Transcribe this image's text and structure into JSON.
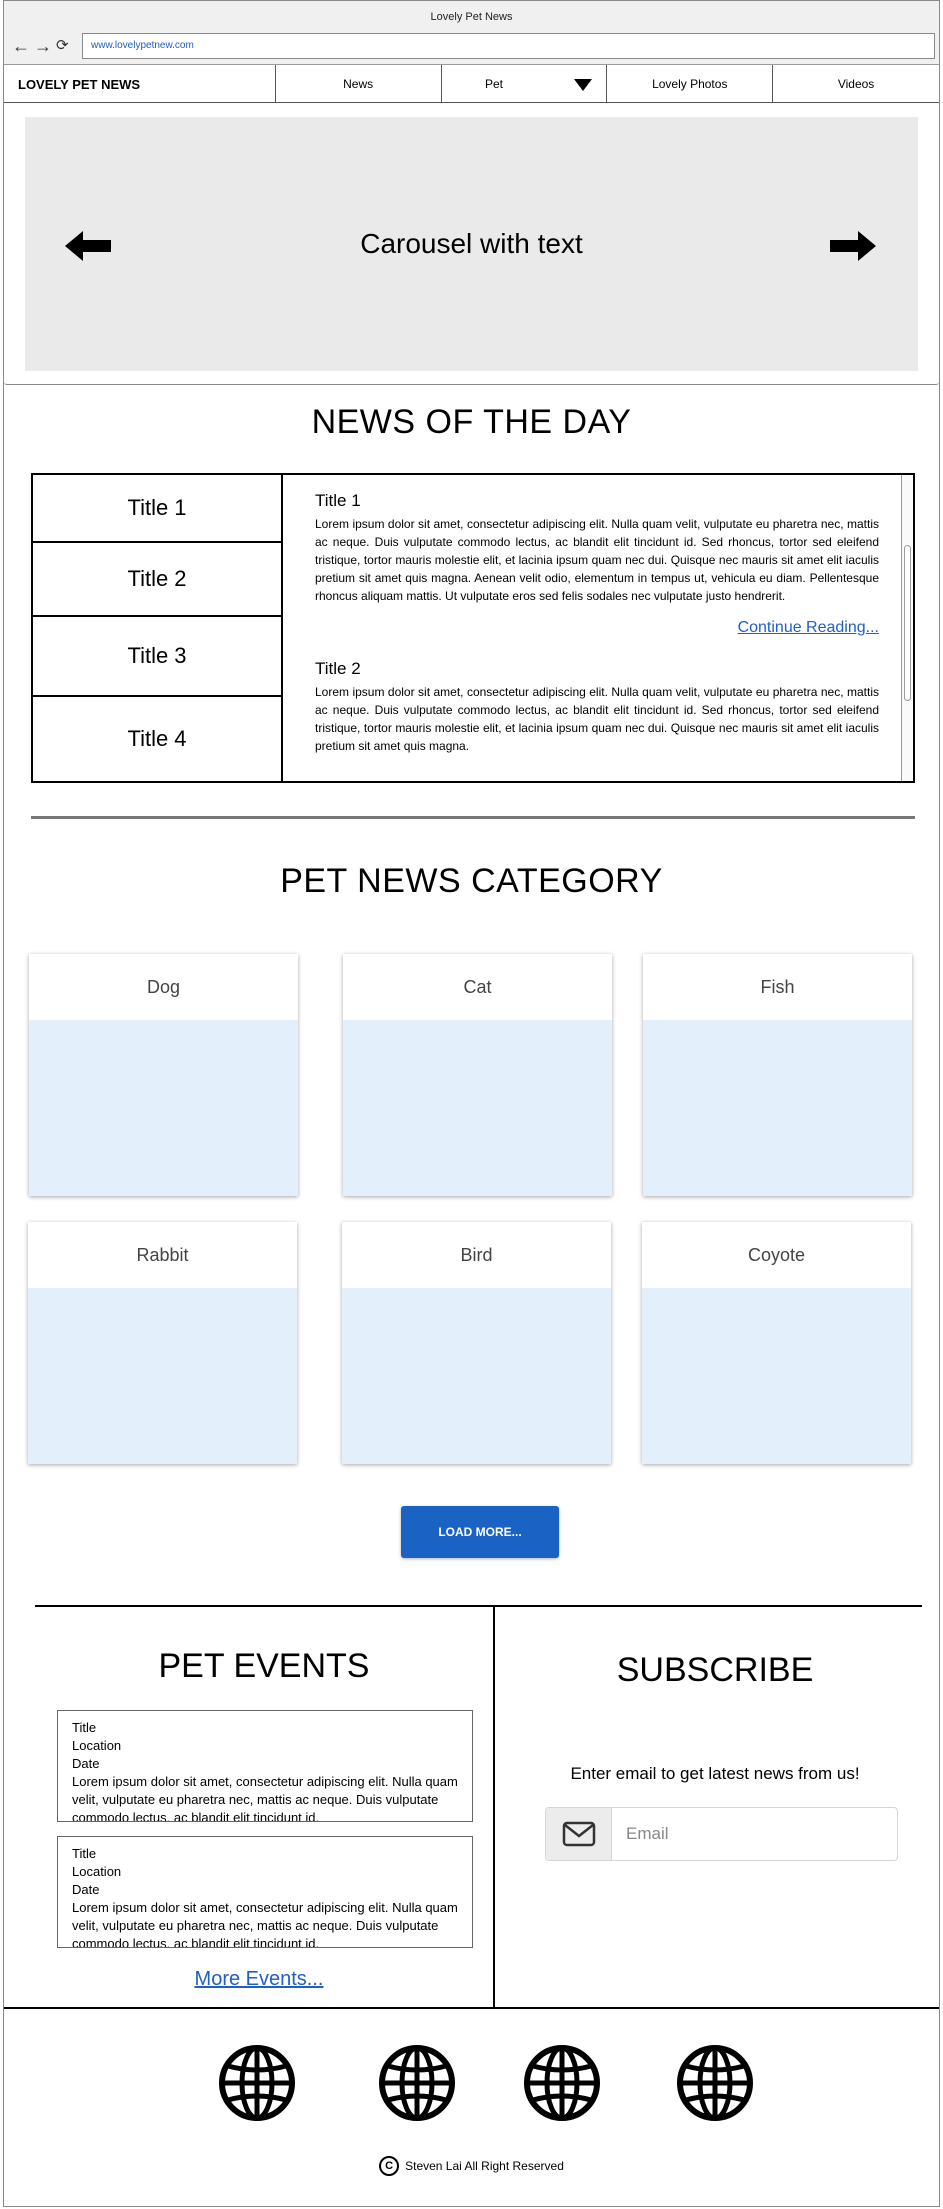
{
  "browser": {
    "window_title": "Lovely Pet News",
    "url": "www.lovelypetnew.com",
    "back_glyph": "←",
    "forward_glyph": "→",
    "reload_glyph": "⟳"
  },
  "nav": {
    "brand": "LOVELY PET NEWS",
    "items": [
      {
        "label": "News"
      },
      {
        "label": "Pet"
      },
      {
        "label": "Lovely Photos"
      },
      {
        "label": "Videos"
      }
    ]
  },
  "carousel": {
    "text": "Carousel with text",
    "left_icon": "arrow-left-icon",
    "right_icon": "arrow-right-icon"
  },
  "news_of_day": {
    "heading": "NEWS OF THE DAY",
    "tabs": [
      {
        "label": "Title 1"
      },
      {
        "label": "Title 2"
      },
      {
        "label": "Title 3"
      },
      {
        "label": "Title 4"
      }
    ],
    "articles": [
      {
        "title": "Title 1",
        "body": "Lorem ipsum dolor sit amet, consectetur adipiscing elit. Nulla quam velit, vulputate eu pharetra nec, mattis ac neque. Duis vulputate commodo lectus, ac blandit elit tincidunt id. Sed rhoncus, tortor sed eleifend tristique, tortor mauris molestie elit, et lacinia ipsum quam nec dui. Quisque nec mauris sit amet elit iaculis pretium sit amet quis magna. Aenean velit odio, elementum in tempus ut, vehicula eu diam. Pellentesque rhoncus aliquam mattis. Ut vulputate eros sed felis sodales nec vulputate justo hendrerit.",
        "continue_label": "Continue Reading..."
      },
      {
        "title": "Title 2",
        "body": "Lorem ipsum dolor sit amet, consectetur adipiscing elit. Nulla quam velit, vulputate eu pharetra nec, mattis ac neque. Duis vulputate commodo lectus, ac blandit elit tincidunt id. Sed rhoncus, tortor sed eleifend tristique, tortor mauris molestie elit, et lacinia ipsum quam nec dui. Quisque nec mauris sit amet elit iaculis pretium sit amet quis magna."
      }
    ]
  },
  "categories": {
    "heading": "PET NEWS CATEGORY",
    "items": [
      {
        "label": "Dog"
      },
      {
        "label": "Cat"
      },
      {
        "label": "Fish"
      },
      {
        "label": "Rabbit"
      },
      {
        "label": "Bird"
      },
      {
        "label": "Coyote"
      }
    ],
    "image_color": "#e3f0fb",
    "load_more_label": "LOAD MORE...",
    "load_more_color": "#1a62c4"
  },
  "events": {
    "heading": "PET EVENTS",
    "cards": [
      {
        "title": "Title",
        "location": "Location",
        "date": "Date",
        "body": "Lorem ipsum dolor sit amet, consectetur adipiscing elit. Nulla quam velit, vulputate eu pharetra nec, mattis ac neque. Duis vulputate commodo lectus, ac blandit elit tincidunt id."
      },
      {
        "title": "Title",
        "location": "Location",
        "date": "Date",
        "body": "Lorem ipsum dolor sit amet, consectetur adipiscing elit. Nulla quam velit, vulputate eu pharetra nec, mattis ac neque. Duis vulputate commodo lectus, ac blandit elit tincidunt id."
      }
    ],
    "more_label": "More Events..."
  },
  "subscribe": {
    "heading": "SUBSCRIBE",
    "text": "Enter email to get latest news from us!",
    "email_placeholder": "Email",
    "email_icon": "envelope-icon"
  },
  "footer": {
    "social_icons": [
      "globe-icon",
      "globe-icon",
      "globe-icon",
      "globe-icon"
    ],
    "copyright_symbol": "C",
    "copyright_text": "Steven Lai All Right Reserved"
  },
  "colors": {
    "link": "#1f5fc4",
    "carousel_bg": "#eaeaea",
    "chrome_bg": "#f0f0f0"
  }
}
